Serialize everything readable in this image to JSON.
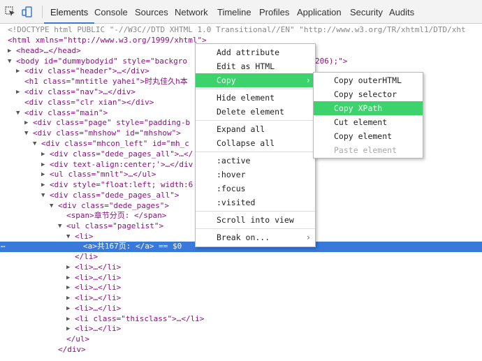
{
  "toolbar": {
    "inspect_icon": "cursor-inspect-icon",
    "device_icon": "device-mode-icon",
    "tabs": [
      {
        "label": "Elements"
      },
      {
        "label": "Console"
      },
      {
        "label": "Sources"
      },
      {
        "label": "Network"
      },
      {
        "label": "Timeline"
      },
      {
        "label": "Profiles"
      },
      {
        "label": "Application"
      },
      {
        "label": "Security"
      },
      {
        "label": "Audits"
      }
    ],
    "active_tab": "Elements",
    "accent_color": "#3879d9"
  },
  "dom_lines": [
    {
      "t": "<!DOCTYPE html PUBLIC \"-//W3C//DTD XHTML 1.0 Transitional//EN\" \"http://www.w3.org/TR/xhtml1/DTD/xht"
    },
    {
      "t": "<html xmlns=\"http://www.w3.org/1999/xhtml\">"
    },
    {
      "t": "<head>…</head>"
    },
    {
      "t": "<body id=\"dummybodyid\" style=\"backgro"
    },
    {
      "t": "206);\">"
    },
    {
      "t": "<div class=\"header\">…</div>"
    },
    {
      "t": "<h1 class=\"mntitle yahei\">时丸佳久h本"
    },
    {
      "t": "<div class=\"nav\">…</div>"
    },
    {
      "t": "<div class=\"clr xian\"></div>"
    },
    {
      "t": "<div class=\"main\">"
    },
    {
      "t": "<div class=\"page\" style=\"padding-b"
    },
    {
      "t": "<div class=\"mhshow\" id=\"mhshow\">"
    },
    {
      "t": "<div class=\"mhcon_left\" id=\"mh_c"
    },
    {
      "t": "<div class=\"dede_pages_all\">…</"
    },
    {
      "t": "<div text-align:center;'>…</div"
    },
    {
      "t": "<ul class=\"mnlt\">…</ul>"
    },
    {
      "t": "<div style=\"float:left; width:6"
    },
    {
      "t": "<div class=\"dede_pages_all\">"
    },
    {
      "t": "<div class=\"dede_pages\">"
    },
    {
      "t": "<span>章节分页: </span>"
    },
    {
      "t": "<ul class=\"pagelist\">"
    },
    {
      "t": "<li>"
    },
    {
      "t": "<a>共167页: </a> == $0"
    },
    {
      "t": "</li>"
    },
    {
      "t": "<li>…</li>"
    },
    {
      "t": "<li>…</li>"
    },
    {
      "t": "<li>…</li>"
    },
    {
      "t": "<li>…</li>"
    },
    {
      "t": "<li>…</li>"
    },
    {
      "t": "<li class=\"thisclass\">…</li>"
    },
    {
      "t": "<li>…</li>"
    },
    {
      "t": "</ul>"
    },
    {
      "t": "</div>"
    }
  ],
  "selected_line_marker": "…",
  "context_menu": {
    "items": [
      {
        "label": "Add attribute"
      },
      {
        "label": "Edit as HTML"
      },
      {
        "label": "Copy",
        "submenu": true
      },
      {
        "label": "Hide element"
      },
      {
        "label": "Delete element"
      },
      {
        "label": "Expand all"
      },
      {
        "label": "Collapse all"
      },
      {
        "label": ":active"
      },
      {
        "label": ":hover"
      },
      {
        "label": ":focus"
      },
      {
        "label": ":visited"
      },
      {
        "label": "Scroll into view"
      },
      {
        "label": "Break on...",
        "submenu": true
      }
    ],
    "arrow_glyph": "›"
  },
  "copy_submenu": {
    "items": [
      {
        "label": "Copy outerHTML"
      },
      {
        "label": "Copy selector"
      },
      {
        "label": "Copy XPath"
      },
      {
        "label": "Cut element"
      },
      {
        "label": "Copy element"
      },
      {
        "label": "Paste element"
      }
    ]
  },
  "menu_highlight_color": "#3cd36d"
}
